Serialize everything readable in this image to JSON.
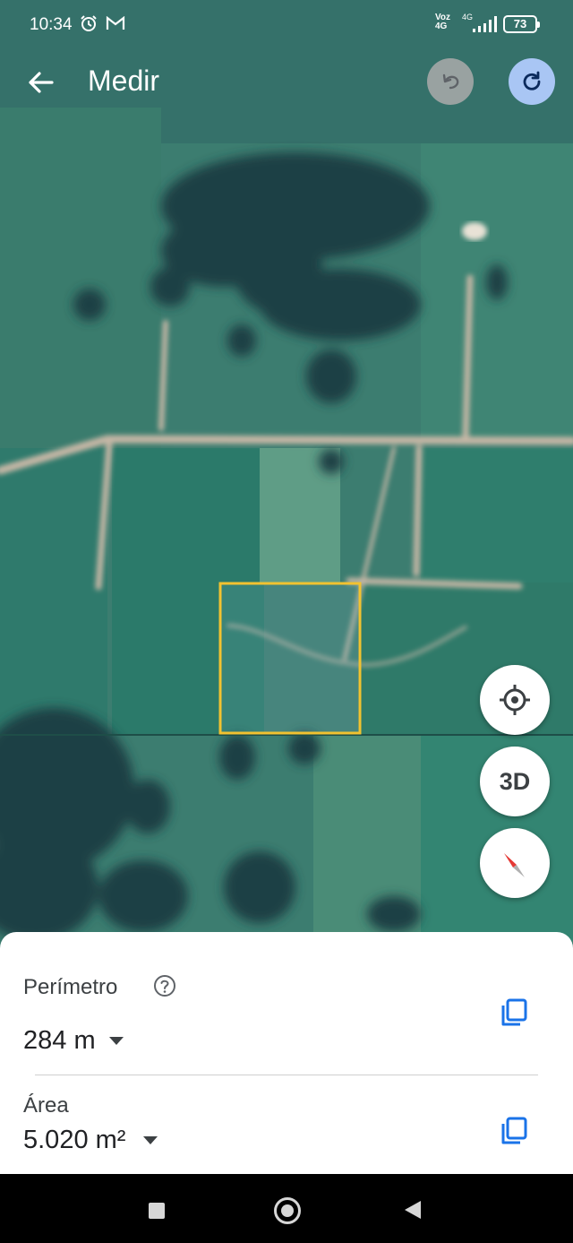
{
  "status_bar": {
    "time": "10:34",
    "volte_top": "Voz",
    "volte_bottom": "4G",
    "network": "4G",
    "battery": "73",
    "icons": [
      "alarm-icon",
      "gmail-icon",
      "signal-icon",
      "battery-icon"
    ]
  },
  "app_bar": {
    "title": "Medir",
    "back_icon": "arrow-left-icon",
    "undo_icon": "undo-icon",
    "redo_icon": "redo-icon"
  },
  "map_controls": {
    "location_icon": "my-location-icon",
    "three_d_label": "3D",
    "compass_icon": "compass-icon"
  },
  "measurement": {
    "perimeter_label": "Perímetro",
    "perimeter_value": "284 m",
    "area_label": "Área",
    "area_value": "5.020 m²",
    "help_icon": "help-circle-icon",
    "copy_icon": "copy-icon"
  },
  "colors": {
    "selection": "#f2c230",
    "accent": "#1a73e8",
    "redo_bg": "#a9c6f4"
  }
}
